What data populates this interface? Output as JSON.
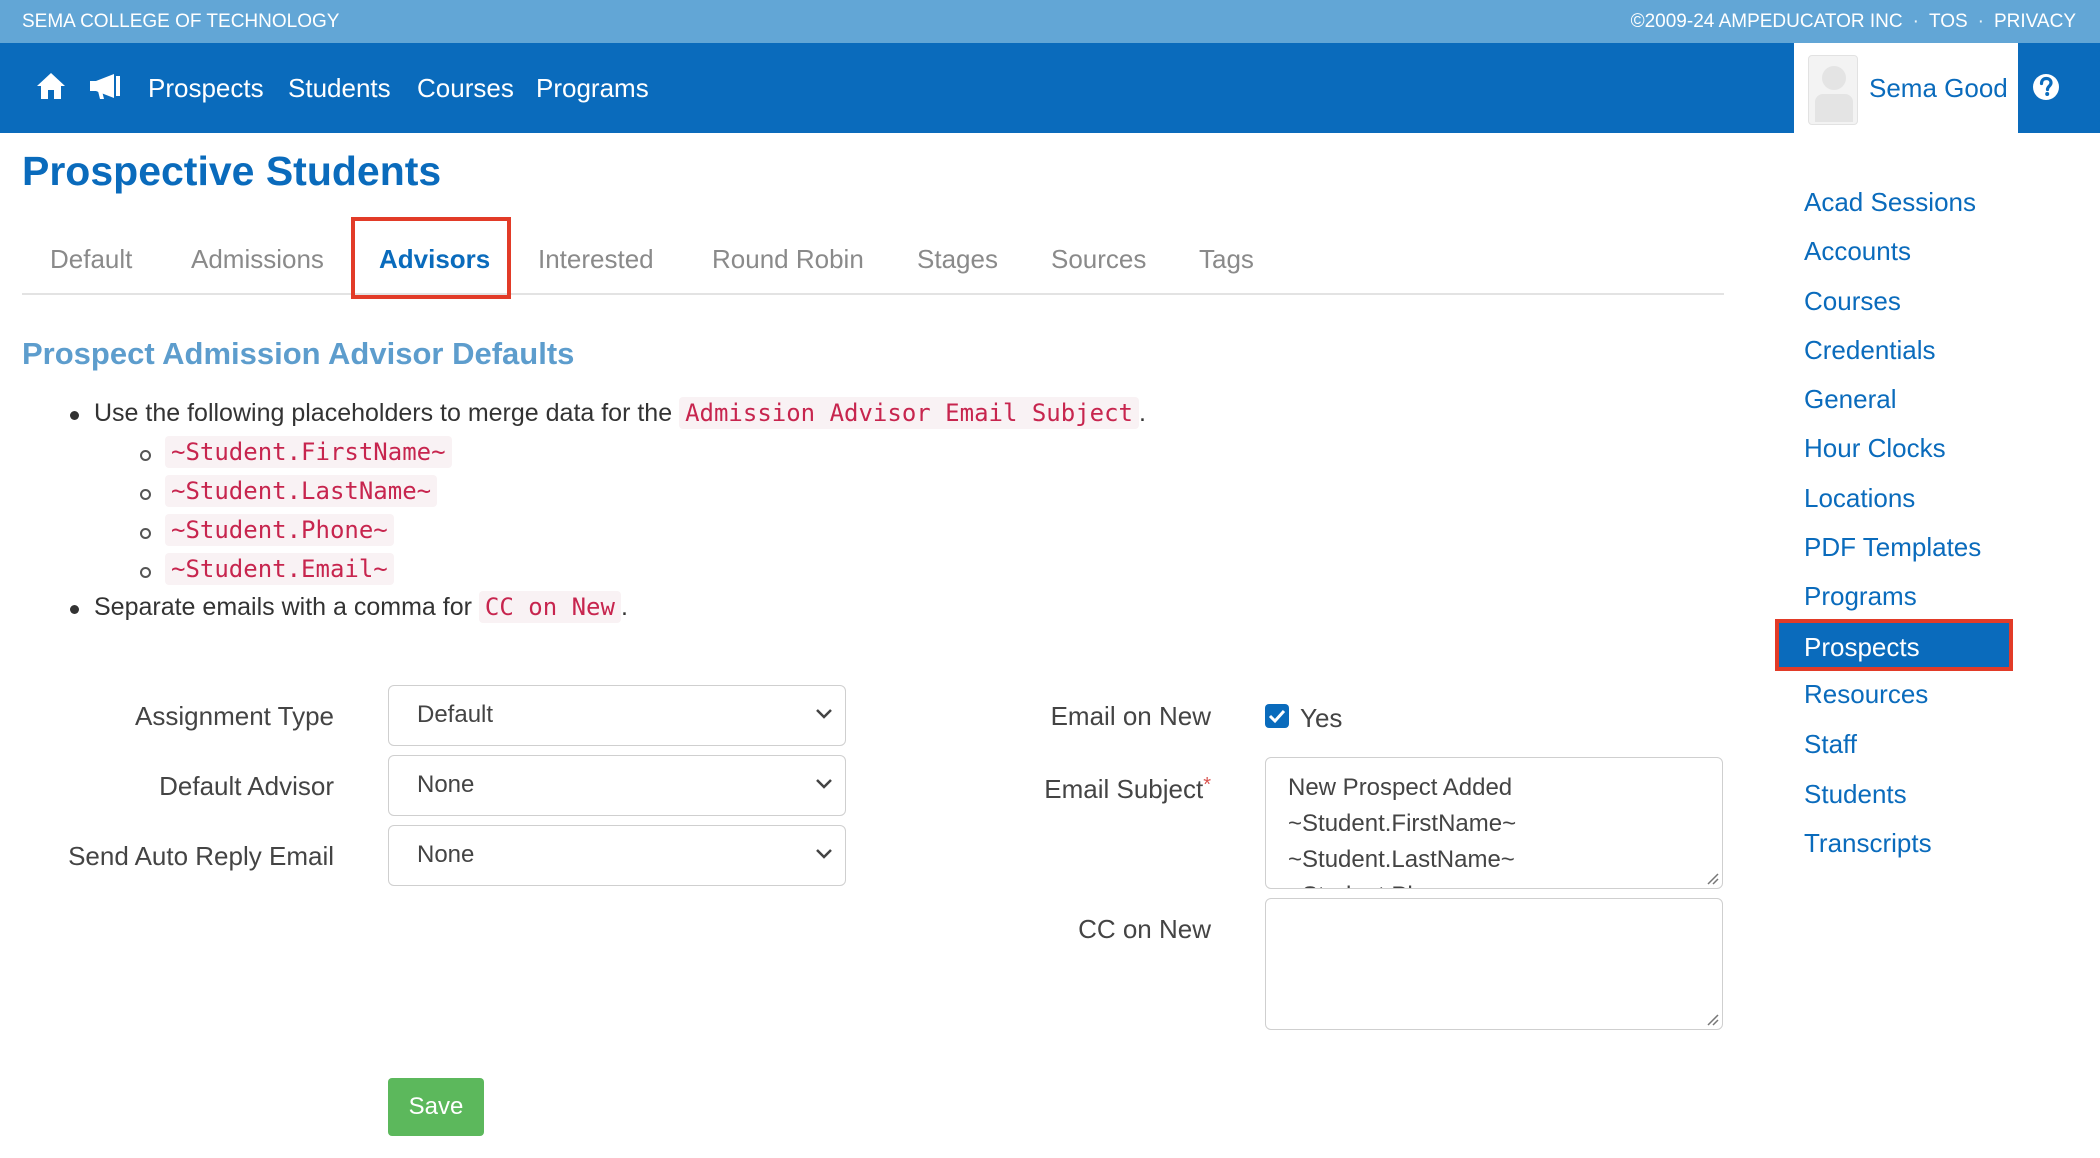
{
  "topbar": {
    "school": "SEMA COLLEGE OF TECHNOLOGY",
    "copyright": "©2009-24 AMPEDUCATOR INC",
    "tos": "TOS",
    "privacy": "PRIVACY",
    "separator": "·"
  },
  "nav": {
    "icons": [
      "home-icon",
      "megaphone-icon"
    ],
    "links": [
      "Prospects",
      "Students",
      "Courses",
      "Programs"
    ],
    "user_name": "Sema Good",
    "help_icon": "question-circle-icon"
  },
  "page_title": "Prospective Students",
  "tabs": [
    "Default",
    "Admissions",
    "Advisors",
    "Interested",
    "Round Robin",
    "Stages",
    "Sources",
    "Tags"
  ],
  "active_tab": "Advisors",
  "section_title": "Prospect Admission Advisor Defaults",
  "info": {
    "line1_text": "Use the following placeholders to merge data for the",
    "line1_code": "Admission Advisor Email Subject",
    "line1_end": ".",
    "placeholders": [
      "~Student.FirstName~",
      "~Student.LastName~",
      "~Student.Phone~",
      "~Student.Email~"
    ],
    "line2_text": "Separate emails with a comma for",
    "line2_code": "CC on New",
    "line2_end": "."
  },
  "form": {
    "assignment_type_label": "Assignment Type",
    "assignment_type_value": "Default",
    "default_advisor_label": "Default Advisor",
    "default_advisor_value": "None",
    "auto_reply_label": "Send Auto Reply Email",
    "auto_reply_value": "None",
    "email_on_new_label": "Email on New",
    "email_on_new_checked": true,
    "email_on_new_option": "Yes",
    "email_subject_label": "Email Subject",
    "required_mark": "*",
    "email_subject_lines": [
      "New Prospect Added",
      "~Student.FirstName~",
      "~Student.LastName~",
      "~Student.Phone~"
    ],
    "cc_on_new_label": "CC on New",
    "cc_on_new_value": "",
    "save_label": "Save"
  },
  "sidebar": {
    "items": [
      "Acad Sessions",
      "Accounts",
      "Courses",
      "Credentials",
      "General",
      "Hour Clocks",
      "Locations",
      "PDF Templates",
      "Programs",
      "Prospects",
      "Resources",
      "Staff",
      "Students",
      "Transcripts"
    ],
    "active": "Prospects"
  },
  "colors": {
    "brand": "#0a6bbc",
    "topbar": "#62a6d6",
    "highlight": "#e23b28",
    "save": "#5cb85c",
    "code": "#c7254e"
  }
}
